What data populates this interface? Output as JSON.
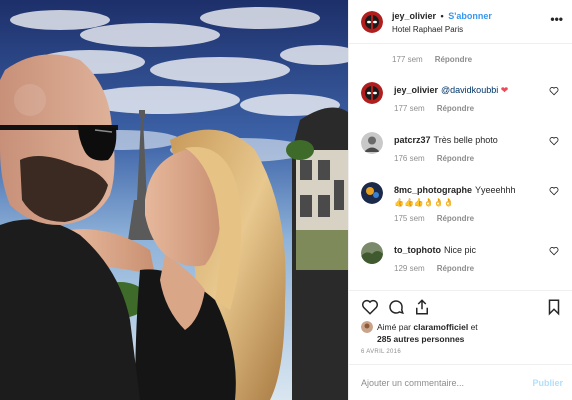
{
  "post": {
    "username": "jey_olivier",
    "separator": "•",
    "follow_label": "S'abonner",
    "location": "Hotel Raphael Paris",
    "more_icon": "ellipsis-icon",
    "first_time": "177 sem",
    "first_reply": "Répondre"
  },
  "comments": [
    {
      "username": "jey_olivier",
      "mention": "@davidkoubbi",
      "text": "",
      "emoji": "❤",
      "time": "177 sem",
      "reply": "Répondre"
    },
    {
      "username": "patcrz37",
      "mention": "",
      "text": "Très belle photo",
      "emoji": "",
      "time": "176 sem",
      "reply": "Répondre"
    },
    {
      "username": "8mc_photographe",
      "mention": "",
      "text": "Yyeeehhh",
      "emoji": "👍👍👍👌👌👌",
      "time": "175 sem",
      "reply": "Répondre"
    },
    {
      "username": "to_tophoto",
      "mention": "",
      "text": "Nice pic",
      "emoji": "",
      "time": "129 sem",
      "reply": "Répondre"
    }
  ],
  "actions": {
    "liked_by_prefix": "Aimé par",
    "liked_by_user": "claramofficiel",
    "liked_by_conj": "et",
    "others": "285 autres personnes",
    "date": "6 AVRIL 2016"
  },
  "add_comment": {
    "placeholder": "Ajouter un commentaire...",
    "publish_label": "Publier"
  },
  "colors": {
    "accent": "#3897f0",
    "publish_disabled": "#b2dffc",
    "muted": "#8e8e8e",
    "heart_emoji": "#ed4956"
  }
}
